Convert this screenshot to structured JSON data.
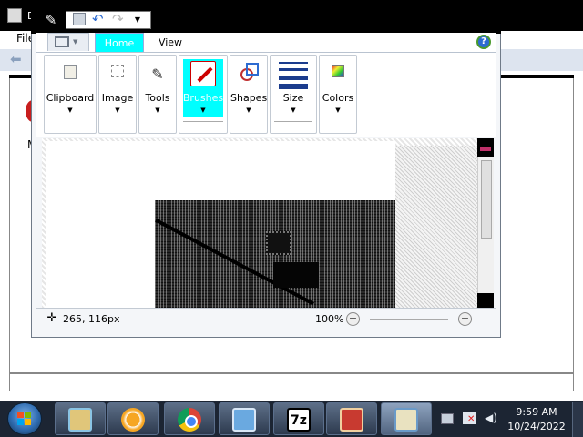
{
  "background_window": {
    "title_fragment": "D",
    "menu_file": "File",
    "content_letter": "M"
  },
  "paint": {
    "tabs": [
      "Home",
      "View"
    ],
    "active_tab": "Home",
    "groups": [
      {
        "label": "Clipboard"
      },
      {
        "label": "Image"
      },
      {
        "label": "Tools"
      },
      {
        "label": "Brushes",
        "selected": true
      },
      {
        "label": "Shapes"
      },
      {
        "label": "Size"
      },
      {
        "label": "Colors"
      }
    ],
    "status": {
      "cursor_position": "265, 116px",
      "zoom": "100%"
    }
  },
  "taskbar": {
    "pinned_icons": [
      "map-app-icon",
      "media-player-icon",
      "chrome-icon",
      "network-map-icon",
      "7zip-icon",
      "toolbox-icon",
      "paint-icon"
    ],
    "tb5_label": "7z",
    "clock": {
      "time": "9:59 AM",
      "date": "10/24/2022"
    }
  },
  "colors": {
    "ribbon_highlight": "#00ffff",
    "taskbar": "#1c2533"
  }
}
